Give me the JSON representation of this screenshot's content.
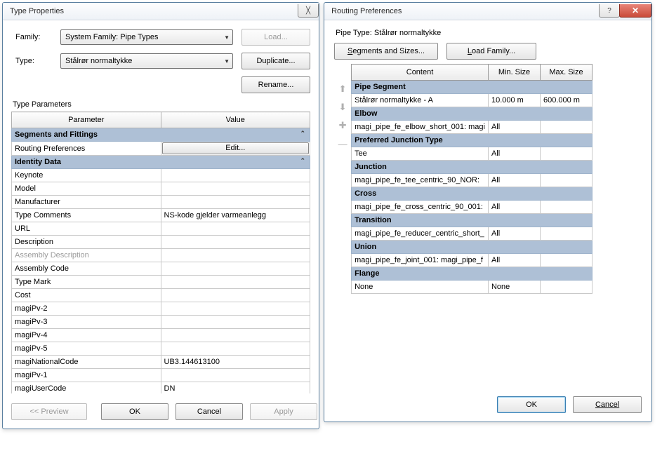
{
  "typeProps": {
    "title": "Type Properties",
    "familyLabel": "Family:",
    "familyValue": "System Family: Pipe Types",
    "typeLabel": "Type:",
    "typeValue": "Stålrør normaltykke",
    "loadBtn": "Load...",
    "duplicateBtn": "Duplicate...",
    "renameBtn": "Rename...",
    "typeParamsLabel": "Type Parameters",
    "colParam": "Parameter",
    "colValue": "Value",
    "groups": [
      {
        "name": "Segments and Fittings",
        "rows": [
          {
            "p": "Routing Preferences",
            "v": "Edit...",
            "isEdit": true
          }
        ]
      },
      {
        "name": "Identity Data",
        "rows": [
          {
            "p": "Keynote",
            "v": ""
          },
          {
            "p": "Model",
            "v": ""
          },
          {
            "p": "Manufacturer",
            "v": ""
          },
          {
            "p": "Type Comments",
            "v": "NS-kode gjelder varmeanlegg"
          },
          {
            "p": "URL",
            "v": ""
          },
          {
            "p": "Description",
            "v": ""
          },
          {
            "p": "Assembly Description",
            "v": "",
            "dim": true
          },
          {
            "p": "Assembly Code",
            "v": ""
          },
          {
            "p": "Type Mark",
            "v": ""
          },
          {
            "p": "Cost",
            "v": ""
          },
          {
            "p": "magiPv-2",
            "v": ""
          },
          {
            "p": "magiPv-3",
            "v": ""
          },
          {
            "p": "magiPv-4",
            "v": ""
          },
          {
            "p": "magiPv-5",
            "v": ""
          },
          {
            "p": "magiNationalCode",
            "v": "UB3.144613100"
          },
          {
            "p": "magiPv-1",
            "v": ""
          },
          {
            "p": "magiUserCode",
            "v": "DN"
          }
        ]
      }
    ],
    "previewBtn": "<< Preview",
    "okBtn": "OK",
    "cancelBtn": "Cancel",
    "applyBtn": "Apply"
  },
  "routingPrefs": {
    "title": "Routing Preferences",
    "pipeTypeLabel": "Pipe Type:",
    "pipeTypeValue": "Stålrør normaltykke",
    "segmentsBtnPre": "S",
    "segmentsBtnRest": "egments and Sizes...",
    "loadFamBtnPre": "L",
    "loadFamBtnRest": "oad Family...",
    "colContent": "Content",
    "colMin": "Min. Size",
    "colMax": "Max. Size",
    "groups": [
      {
        "name": "Pipe Segment",
        "rows": [
          {
            "c": "Stålrør normaltykke - A",
            "min": "10.000 m",
            "max": "600.000 m"
          }
        ]
      },
      {
        "name": "Elbow",
        "rows": [
          {
            "c": "magi_pipe_fe_elbow_short_001: magi",
            "min": "All",
            "max": ""
          }
        ]
      },
      {
        "name": "Preferred Junction Type",
        "rows": [
          {
            "c": "Tee",
            "min": "All",
            "max": ""
          }
        ]
      },
      {
        "name": "Junction",
        "rows": [
          {
            "c": "magi_pipe_fe_tee_centric_90_NOR:",
            "min": "All",
            "max": ""
          }
        ]
      },
      {
        "name": "Cross",
        "rows": [
          {
            "c": "magi_pipe_fe_cross_centric_90_001:",
            "min": "All",
            "max": ""
          }
        ]
      },
      {
        "name": "Transition",
        "rows": [
          {
            "c": "magi_pipe_fe_reducer_centric_short_",
            "min": "All",
            "max": ""
          }
        ]
      },
      {
        "name": "Union",
        "rows": [
          {
            "c": "magi_pipe_fe_joint_001: magi_pipe_f",
            "min": "All",
            "max": ""
          }
        ]
      },
      {
        "name": "Flange",
        "rows": [
          {
            "c": "None",
            "min": "None",
            "max": ""
          }
        ]
      }
    ],
    "okBtn": "OK",
    "cancelBtn": "Cancel"
  }
}
